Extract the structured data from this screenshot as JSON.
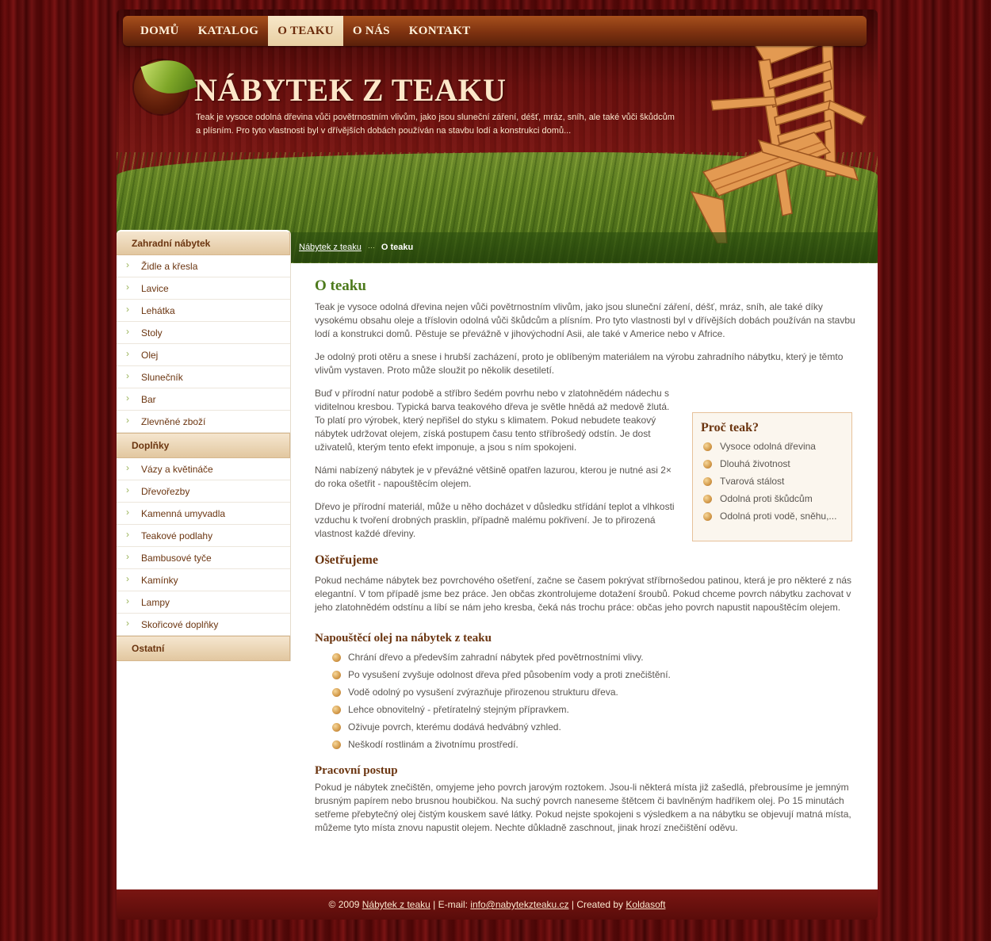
{
  "nav": [
    "DOMŮ",
    "KATALOG",
    "O TEAKU",
    "O NÁS",
    "KONTAKT"
  ],
  "nav_active": "O TEAKU",
  "header": {
    "title": "NÁBYTEK Z TEAKU",
    "desc": "Teak je vysoce odolná dřevina vůči povětrnostním vlivům, jako jsou sluneční záření, déšť, mráz, sníh, ale také vůči škůdcům a plísním. Pro tyto vlastnosti byl v dřívějších dobách používán na stavbu lodí a konstrukci domů..."
  },
  "breadcrumb": {
    "home": "Nábytek z teaku",
    "current": "O teaku"
  },
  "sidebar": {
    "sections": [
      {
        "title": "Zahradní nábytek",
        "items": [
          "Židle a křesla",
          "Lavice",
          "Lehátka",
          "Stoly",
          "Olej",
          "Slunečník",
          "Bar",
          "Zlevněné zboží"
        ]
      },
      {
        "title": "Doplňky",
        "items": [
          "Vázy a květináče",
          "Dřevořezby",
          "Kamenná umyvadla",
          "Teakové podlahy",
          "Bambusové tyče",
          "Kamínky",
          "Lampy",
          "Skořicové doplňky"
        ]
      },
      {
        "title": "Ostatní",
        "items": []
      }
    ]
  },
  "content": {
    "title": "O teaku",
    "p1": "Teak je vysoce odolná dřevina nejen vůči povětrnostním vlivům, jako jsou sluneční záření, déšť, mráz, sníh, ale také díky vysokému obsahu oleje a tříslovin odolná vůči škůdcům a plísním. Pro tyto vlastnosti byl v dřívějších dobách používán na stavbu lodí a konstrukci domů. Pěstuje se převážně v jihovýchodní Asii, ale také v Americe nebo v Africe.",
    "p2": "Je odolný proti otěru a snese i hrubší zacházení, proto je oblíbeným materiálem na výrobu zahradního nábytku, který je těmto vlivům vystaven. Proto může sloužit po několik desetiletí.",
    "p3": "Buď v přírodní natur podobě a stříbro šedém povrhu nebo v zlatohnědém nádechu s viditelnou kresbou. Typická barva teakového dřeva je světle hnědá až medově žlutá. To platí pro výrobek, který nepřišel do styku s klimatem. Pokud nebudete teakový nábytek udržovat olejem, získá postupem času tento stříbrošedý odstín. Je dost uživatelů, kterým tento efekt imponuje, a jsou s ním spokojeni.",
    "p4": "Námi nabízený nábytek je v převážné většině opatřen lazurou, kterou je nutné asi 2× do roka ošetřit - napouštěcím olejem.",
    "p5": "Dřevo je přírodní materiál, může u něho docházet v důsledku střídání teplot a vlhkosti vzduchu k tvoření drobných prasklin, případně malému pokřivení. Je to přirozená vlastnost každé dřeviny.",
    "why_title": "Proč teak?",
    "why_items": [
      "Vysoce odolná dřevina",
      "Dlouhá životnost",
      "Tvarová stálost",
      "Odolná proti škůdcům",
      "Odolná proti vodě, sněhu,..."
    ],
    "h_care": "Ošetřujeme",
    "p_care": "Pokud necháme nábytek bez povrchového ošetření, začne se časem pokrývat stříbrnošedou patinou, která je pro některé z nás elegantní. V tom případě jsme bez práce. Jen občas zkontrolujeme dotažení šroubů. Pokud chceme povrch nábytku zachovat v jeho zlatohnědém odstínu a líbí se nám jeho kresba, čeká nás trochu práce: občas jeho povrch napustit napouštěcím olejem.",
    "h_oil": "Napouštěcí olej na nábytek z teaku",
    "oil_items": [
      "Chrání dřevo a především zahradní nábytek před povětrnostními vlivy.",
      "Po vysušení zvyšuje odolnost dřeva před působením vody a proti znečištění.",
      "Vodě odolný po vysušení zvýrazňuje přirozenou strukturu dřeva.",
      "Lehce obnovitelný - přetíratelný stejným přípravkem.",
      "Oživuje povrch, kterému dodává hedvábný vzhled.",
      "Neškodí rostlinám a životnímu prostředí."
    ],
    "h_proc": "Pracovní postup",
    "p_proc": "Pokud je nábytek znečištěn, omyjeme jeho povrch jarovým roztokem. Jsou-li některá místa již zašedlá, přebrousíme je jemným brusným papírem nebo brusnou houbičkou. Na suchý povrch naneseme štětcem či bavlněným hadříkem olej. Po 15 minutách setřeme přebytečný olej čistým kouskem savé látky. Pokud nejste spokojeni s výsledkem a na nábytku se objevují matná místa, můžeme tyto místa znovu napustit olejem. Nechte důkladně zaschnout, jinak hrozí znečištění oděvu."
  },
  "footer": {
    "copy": "© 2009",
    "site_link": "Nábytek z teaku",
    "email_label": "| E-mail:",
    "email": "info@nabytekzteaku.cz",
    "created_label": "| Created by",
    "creator": "Koldasoft"
  },
  "colors": {
    "accent_green": "#4d7a1c",
    "brown": "#6b3510",
    "wood_red": "#5a0a0a"
  }
}
